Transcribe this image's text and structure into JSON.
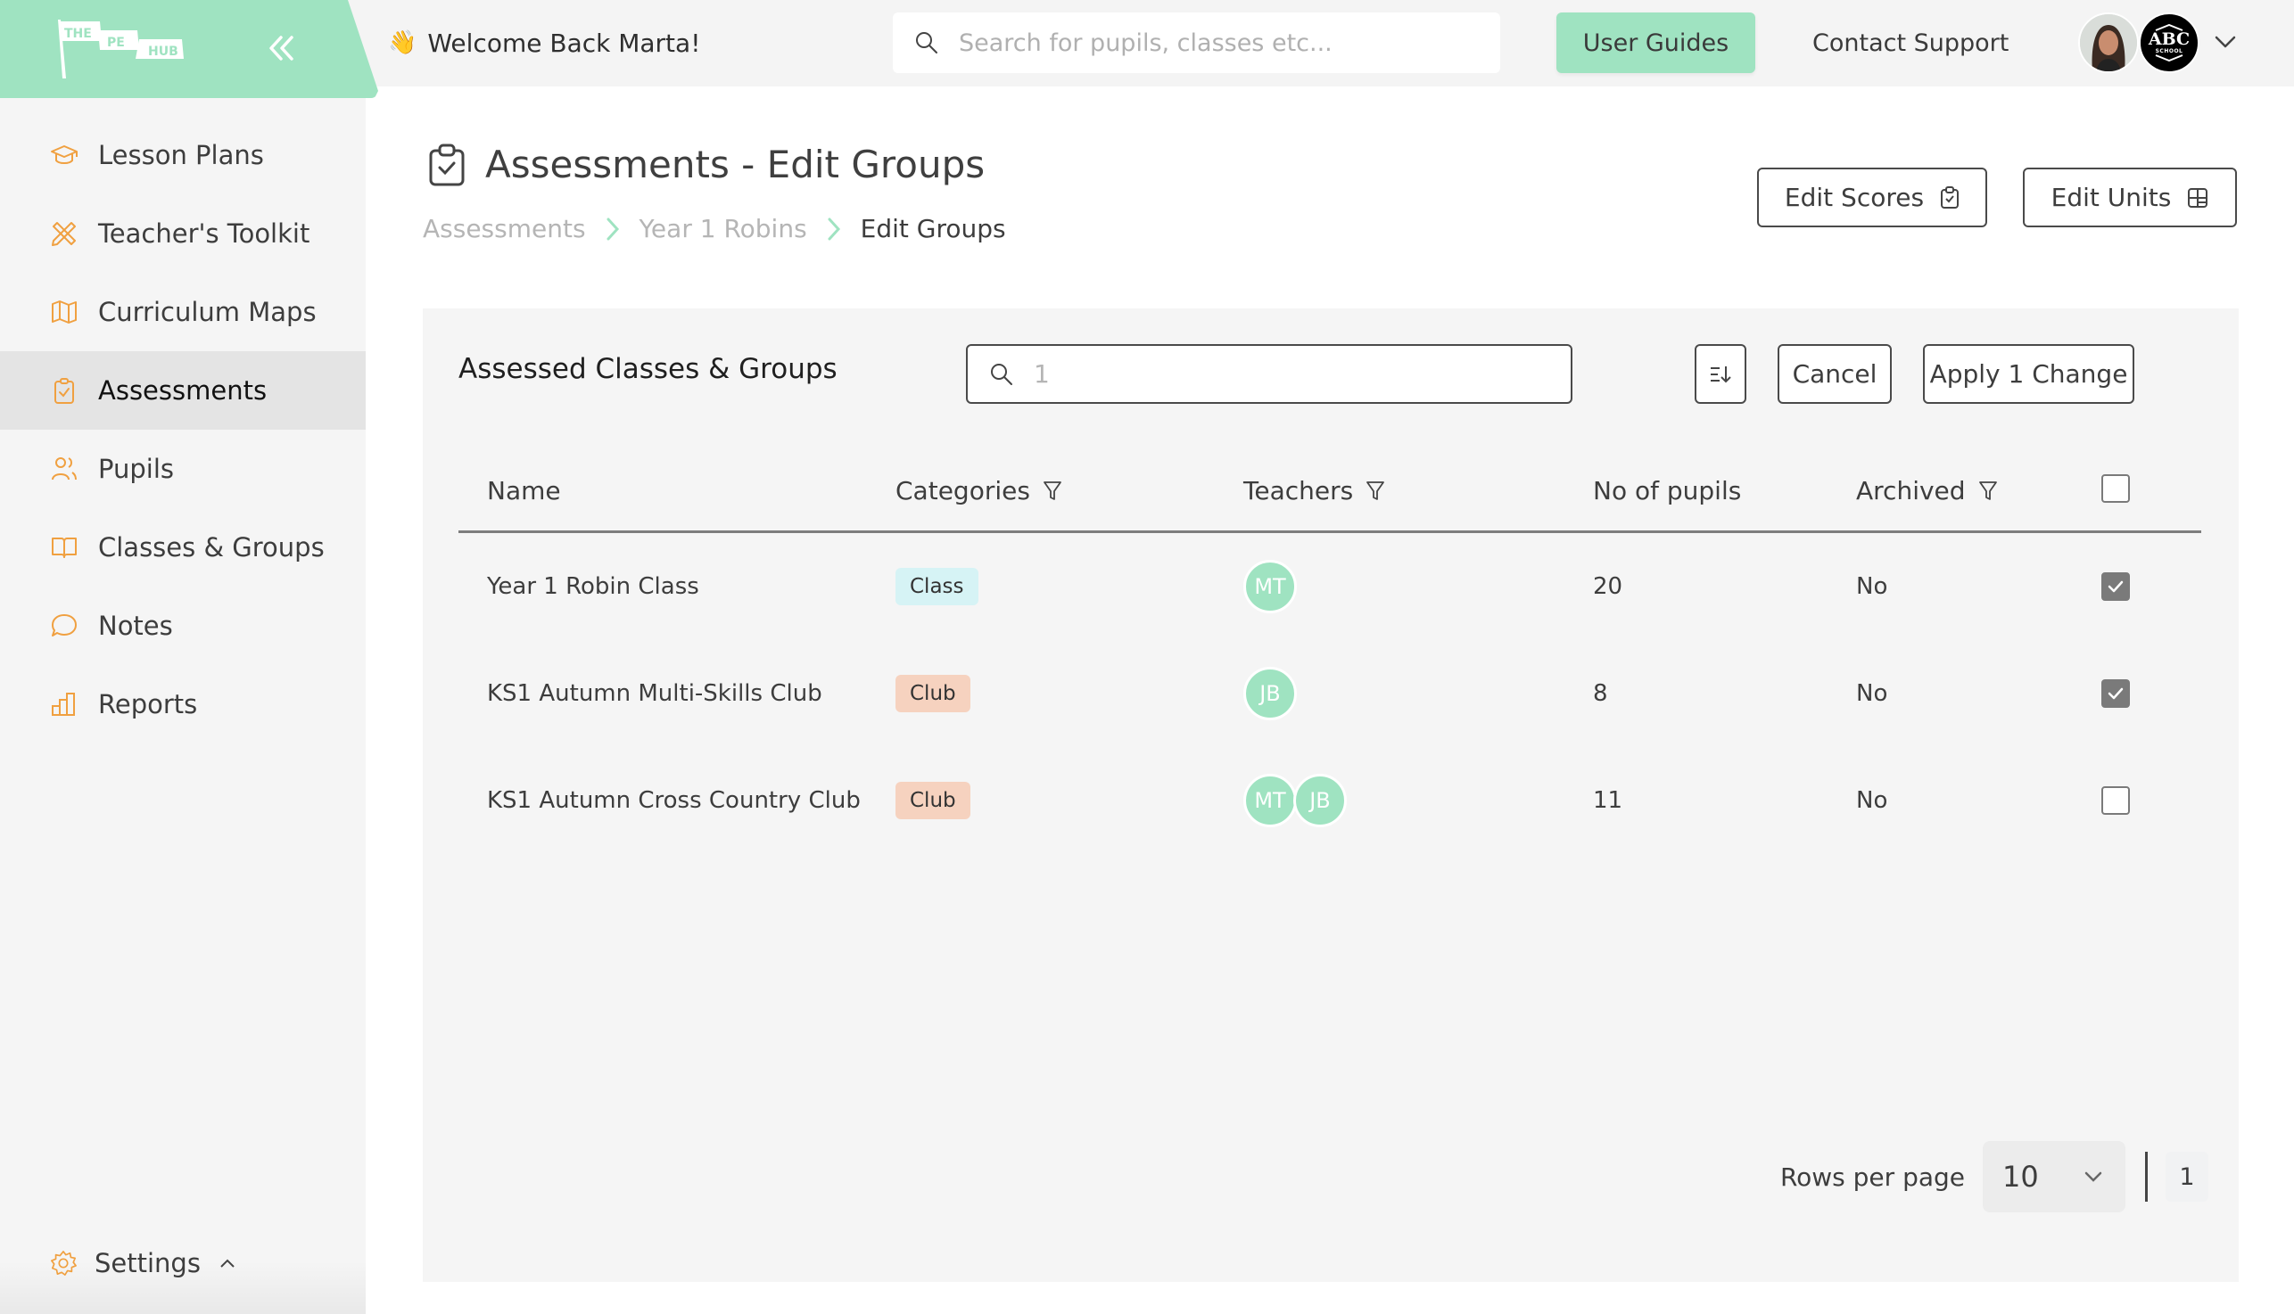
{
  "brand": {
    "logo_words": [
      "THE",
      "PE",
      "HUB"
    ],
    "accent_color": "#9fe3c1",
    "icon_color": "#f0a040"
  },
  "topbar": {
    "welcome_emoji": "👋",
    "welcome_text": "Welcome Back Marta!",
    "search_placeholder": "Search for pupils, classes etc...",
    "user_guides_label": "User Guides",
    "contact_support_label": "Contact Support",
    "school_badge_main": "ABC",
    "school_badge_sub": "SCHOOL"
  },
  "sidebar": {
    "items": [
      {
        "label": "Lesson Plans",
        "icon": "graduation-cap-icon",
        "active": false
      },
      {
        "label": "Teacher's Toolkit",
        "icon": "pencil-ruler-icon",
        "active": false
      },
      {
        "label": "Curriculum Maps",
        "icon": "map-icon",
        "active": false
      },
      {
        "label": "Assessments",
        "icon": "clipboard-check-icon",
        "active": true
      },
      {
        "label": "Pupils",
        "icon": "users-icon",
        "active": false
      },
      {
        "label": "Classes & Groups",
        "icon": "book-open-icon",
        "active": false
      },
      {
        "label": "Notes",
        "icon": "speech-bubble-icon",
        "active": false
      },
      {
        "label": "Reports",
        "icon": "bar-chart-icon",
        "active": false
      }
    ],
    "settings_label": "Settings"
  },
  "page": {
    "title": "Assessments - Edit Groups",
    "breadcrumb": [
      "Assessments",
      "Year 1 Robins",
      "Edit Groups"
    ],
    "edit_scores_label": "Edit Scores",
    "edit_units_label": "Edit Units"
  },
  "card": {
    "title": "Assessed Classes & Groups",
    "search_value": "1",
    "cancel_label": "Cancel",
    "apply_label": "Apply 1 Change",
    "columns": [
      "Name",
      "Categories",
      "Teachers",
      "No of pupils",
      "Archived"
    ],
    "rows": [
      {
        "name": "Year 1 Robin Class",
        "category": "Class",
        "category_color": "#d6f3f5",
        "teachers": [
          "MT"
        ],
        "pupils": "20",
        "archived": "No",
        "selected": true
      },
      {
        "name": "KS1 Autumn Multi-Skills Club",
        "category": "Club",
        "category_color": "#f6d2bf",
        "teachers": [
          "JB"
        ],
        "pupils": "8",
        "archived": "No",
        "selected": true
      },
      {
        "name": "KS1 Autumn Cross Country Club",
        "category": "Club",
        "category_color": "#f6d2bf",
        "teachers": [
          "MT",
          "JB"
        ],
        "pupils": "11",
        "archived": "No",
        "selected": false
      }
    ],
    "select_all_checked": false,
    "pagination": {
      "rows_per_page_label": "Rows per page",
      "rows_per_page": "10",
      "current_page": "1"
    }
  }
}
